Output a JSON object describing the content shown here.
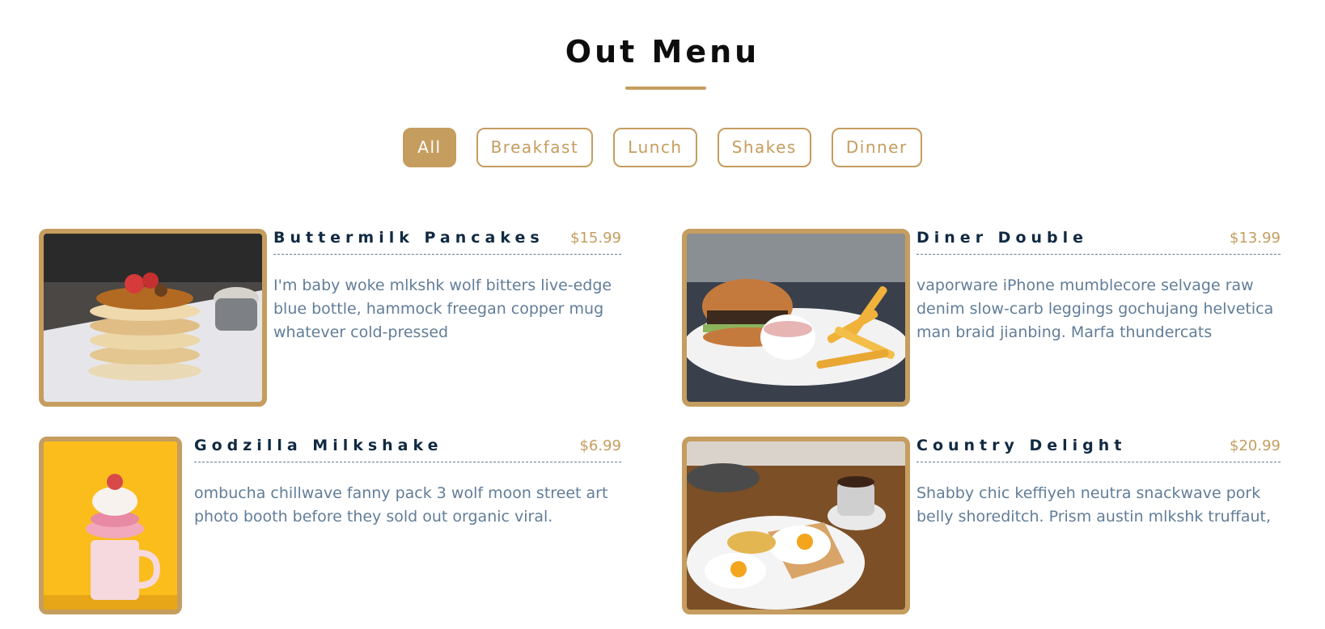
{
  "title": "Out Menu",
  "filters": [
    "All",
    "Breakfast",
    "Lunch",
    "Shakes",
    "Dinner"
  ],
  "active_filter": "All",
  "items": [
    {
      "name": "Buttermilk Pancakes",
      "price": "$15.99",
      "desc": "I'm baby woke mlkshk wolf bitters live-edge blue bottle, hammock freegan copper mug whatever cold-pressed",
      "image": "pancakes-photo"
    },
    {
      "name": "Diner Double",
      "price": "$13.99",
      "desc": "vaporware iPhone mumblecore selvage raw denim slow-carb leggings gochujang helvetica man braid jianbing. Marfa thundercats",
      "image": "burger-photo"
    },
    {
      "name": "Godzilla Milkshake",
      "price": "$6.99",
      "desc": "ombucha chillwave fanny pack 3 wolf moon street art photo booth before they sold out organic viral.",
      "image": "milkshake-photo"
    },
    {
      "name": "Country Delight",
      "price": "$20.99",
      "desc": "Shabby chic keffiyeh neutra snackwave pork belly shoreditch. Prism austin mlkshk truffaut,",
      "image": "eggs-photo"
    }
  ],
  "colors": {
    "accent": "#c59d5f",
    "heading": "#102a42",
    "text": "#617d98"
  }
}
